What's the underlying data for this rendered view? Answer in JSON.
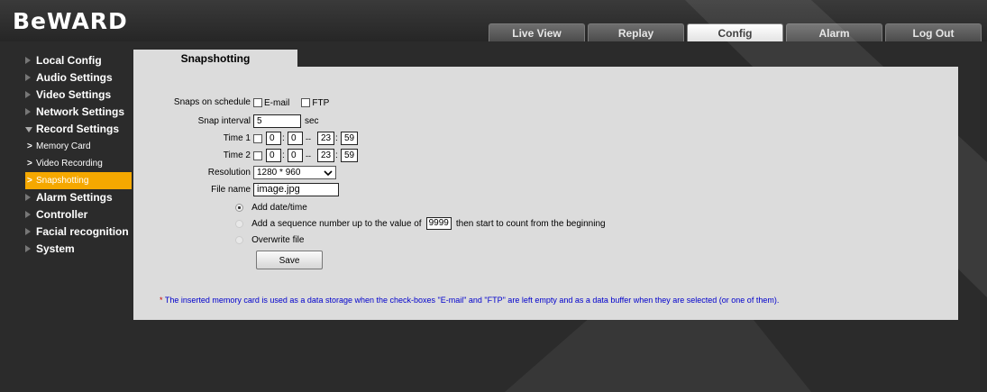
{
  "header": {
    "logo": "BeWARD",
    "tabs": [
      {
        "label": "Live View",
        "active": false
      },
      {
        "label": "Replay",
        "active": false
      },
      {
        "label": "Config",
        "active": true
      },
      {
        "label": "Alarm",
        "active": false
      },
      {
        "label": "Log Out",
        "active": false
      }
    ]
  },
  "sidebar": {
    "items": [
      {
        "label": "Local Config"
      },
      {
        "label": "Audio Settings"
      },
      {
        "label": "Video Settings"
      },
      {
        "label": "Network Settings"
      },
      {
        "label": "Record Settings"
      },
      {
        "label": "Memory Card"
      },
      {
        "label": "Video Recording"
      },
      {
        "label": "Snapshotting"
      },
      {
        "label": "Alarm Settings"
      },
      {
        "label": "Controller"
      },
      {
        "label": "Facial recognition"
      },
      {
        "label": "System"
      }
    ],
    "active_color": "#f5a800"
  },
  "form": {
    "tab_title": "Snapshotting",
    "schedule_label": "Snaps on schedule",
    "email_label": "E-mail",
    "email_checked": false,
    "ftp_label": "FTP",
    "ftp_checked": false,
    "interval_label": "Snap interval",
    "interval_value": "5",
    "interval_unit": "sec",
    "time1_label": "Time 1",
    "time1": {
      "enabled": false,
      "start_h": "0",
      "start_m": "0",
      "end_h": "23",
      "end_m": "59"
    },
    "time2_label": "Time 2",
    "time2": {
      "enabled": false,
      "start_h": "0",
      "start_m": "0",
      "end_h": "23",
      "end_m": "59"
    },
    "time_colon": ":",
    "time_dash": "--",
    "resolution_label": "Resolution",
    "resolution_value": "1280 * 960",
    "filename_label": "File name",
    "filename_value": "image.jpg",
    "option_add_datetime": "Add date/time",
    "option_sequence_pre": "Add a sequence number up to the value of",
    "option_sequence_value": "9999",
    "option_sequence_post": "then start to count from the beginning",
    "option_overwrite": "Overwrite file",
    "selected_option": "Add date/time",
    "save_label": "Save",
    "note_star": "*",
    "note": "The inserted memory card is used as a data storage when the check-boxes \"E-mail\" and \"FTP\" are left empty and as a data buffer when they are selected (or one of them)."
  }
}
